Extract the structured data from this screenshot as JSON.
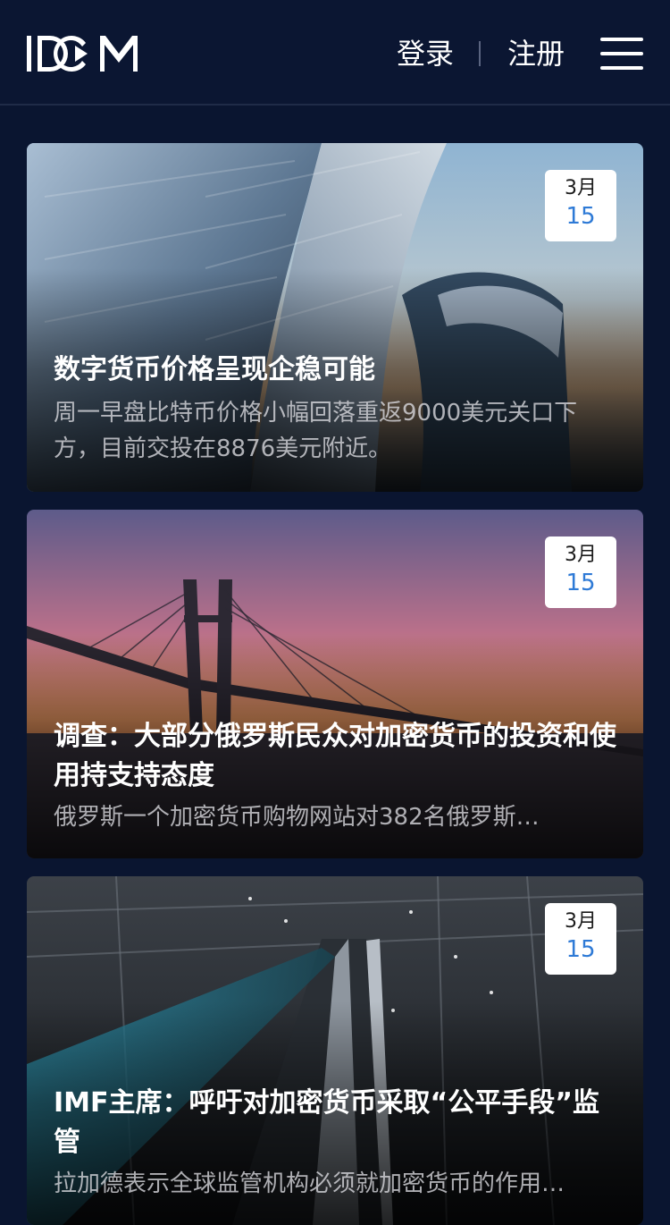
{
  "header": {
    "logo_text": "IDCM",
    "login_label": "登录",
    "register_label": "注册"
  },
  "articles": [
    {
      "date_month": "3月",
      "date_day": "15",
      "title": "数字货币价格呈现企稳可能",
      "summary": "周一早盘比特币价格小幅回落重返9000美元关口下方，目前交投在8876美元附近。"
    },
    {
      "date_month": "3月",
      "date_day": "15",
      "title": "调查：大部分俄罗斯民众对加密货币的投资和使用持支持态度",
      "summary": "俄罗斯一个加密货币购物网站对382名俄罗斯…"
    },
    {
      "date_month": "3月",
      "date_day": "15",
      "title": "IMF主席：呼吁对加密货币采取“公平手段”监管",
      "summary": "拉加德表示全球监管机构必须就加密货币的作用…"
    }
  ],
  "colors": {
    "background": "#0a1530",
    "date_day": "#2e7ad6"
  }
}
